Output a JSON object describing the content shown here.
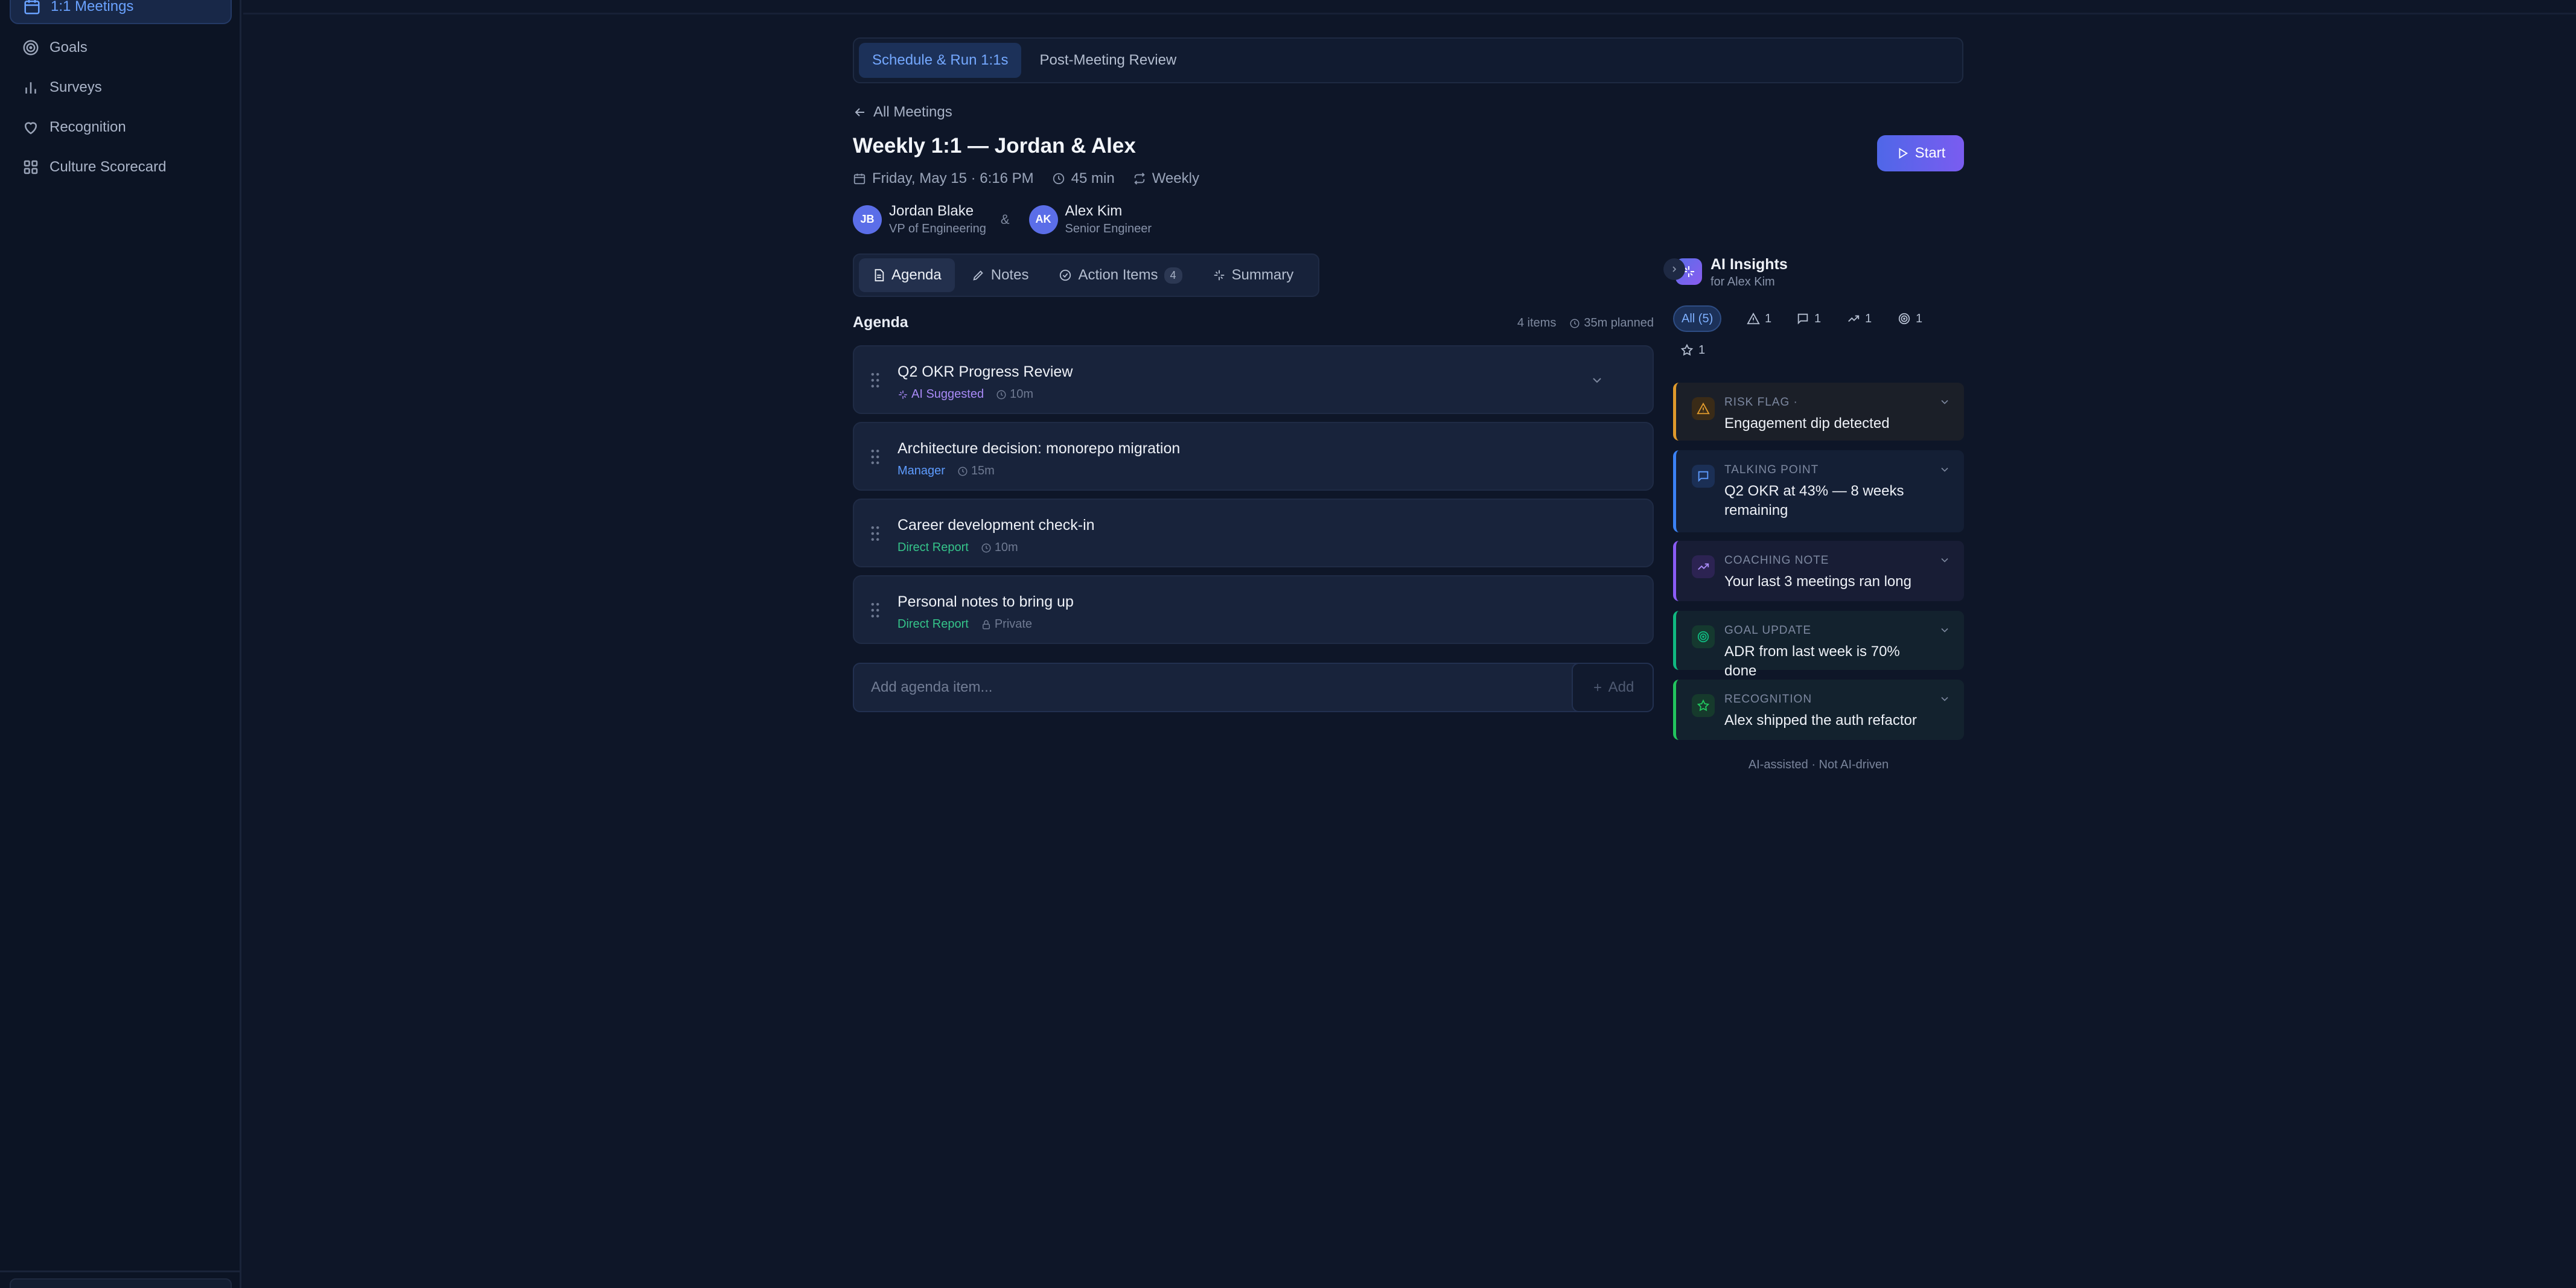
{
  "sidebar": {
    "items": [
      {
        "label": "1:1 Meetings",
        "icon": "calendar-icon",
        "active": true
      },
      {
        "label": "Goals",
        "icon": "target-icon"
      },
      {
        "label": "Surveys",
        "icon": "bar-chart-icon"
      },
      {
        "label": "Recognition",
        "icon": "heart-icon"
      },
      {
        "label": "Culture Scorecard",
        "icon": "grid-icon"
      }
    ]
  },
  "mode_tabs": [
    {
      "label": "Schedule & Run 1:1s",
      "active": true
    },
    {
      "label": "Post-Meeting Review"
    }
  ],
  "header": {
    "back_label": "All Meetings",
    "title": "Weekly 1:1 — Jordan & Alex",
    "date": "Friday, May 15 · 6:16 PM",
    "duration": "45 min",
    "recurrence": "Weekly",
    "start_label": "Start"
  },
  "people": {
    "manager": {
      "initials": "JB",
      "name": "Jordan Blake",
      "role": "VP of Engineering"
    },
    "separator": "&",
    "report": {
      "initials": "AK",
      "name": "Alex Kim",
      "role": "Senior Engineer"
    }
  },
  "view_tabs": [
    {
      "label": "Agenda",
      "icon": "document-icon",
      "active": true
    },
    {
      "label": "Notes",
      "icon": "pencil-icon"
    },
    {
      "label": "Action Items",
      "icon": "check-circle-icon",
      "count": "4"
    },
    {
      "label": "Summary",
      "icon": "sparkle-icon"
    }
  ],
  "agenda": {
    "heading": "Agenda",
    "item_count": "4 items",
    "planned": "35m planned",
    "items": [
      {
        "title": "Q2 OKR Progress Review",
        "tag": "AI Suggested",
        "meta": "10m"
      },
      {
        "title": "Architecture decision: monorepo migration",
        "tag": "Manager",
        "meta": "15m"
      },
      {
        "title": "Career development check-in",
        "tag": "Direct Report",
        "meta": "10m"
      },
      {
        "title": "Personal notes to bring up",
        "tag": "Direct Report",
        "meta": "Private"
      }
    ],
    "add_placeholder": "Add agenda item...",
    "add_label": "Add"
  },
  "insights": {
    "title": "AI Insights",
    "subtitle": "for Alex Kim",
    "filters": [
      {
        "label": "All (5)",
        "active": true
      },
      {
        "label": "1",
        "icon": "alert-triangle-icon"
      },
      {
        "label": "1",
        "icon": "message-icon"
      },
      {
        "label": "1",
        "icon": "trending-up-icon"
      },
      {
        "label": "1",
        "icon": "target-icon"
      },
      {
        "label": "1",
        "icon": "star-icon"
      }
    ],
    "cards": [
      {
        "type": "Risk Flag",
        "marker": "·",
        "text": "Engagement dip detected",
        "color": "#e09a2c"
      },
      {
        "type": "Talking Point",
        "text": "Q2 OKR at 43% — 8 weeks remaining",
        "color": "#3b82f6"
      },
      {
        "type": "Coaching Note",
        "text": "Your last 3 meetings ran long",
        "color": "#8b5cf6"
      },
      {
        "type": "Goal Update",
        "text": "ADR from last week is 70% done",
        "color": "#10b981"
      },
      {
        "type": "Recognition",
        "text": "Alex shipped the auth refactor",
        "color": "#22c55e"
      }
    ],
    "disclaimer": "AI-assisted · Not AI-driven"
  }
}
